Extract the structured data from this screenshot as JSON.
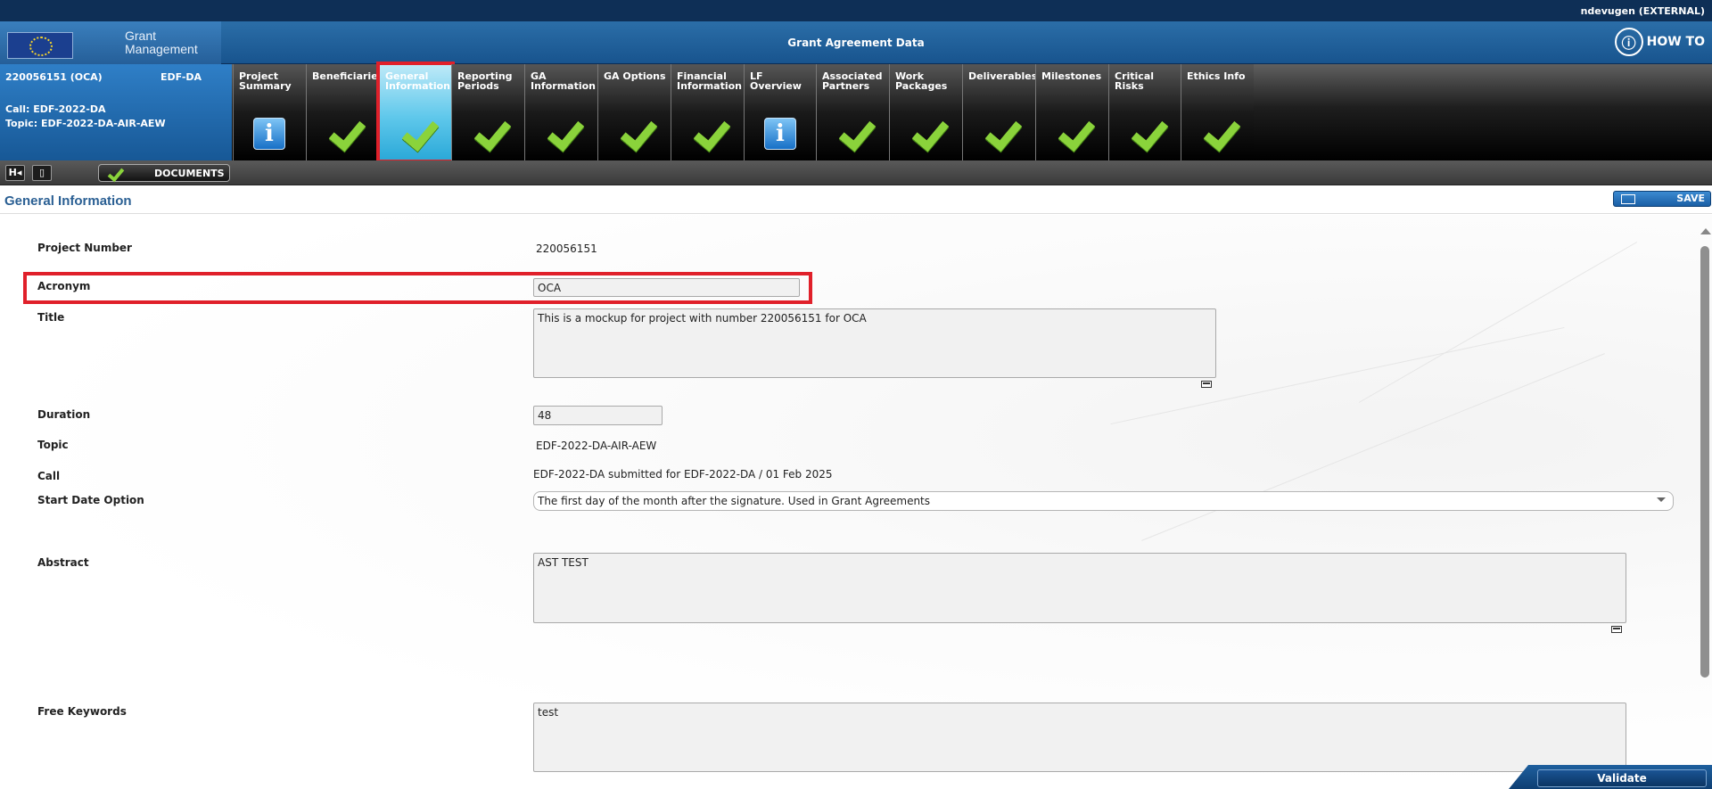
{
  "user": "ndevugen (EXTERNAL)",
  "brand": {
    "line1": "Grant",
    "line2": "Management"
  },
  "header_title": "Grant Agreement Data",
  "howto_label": "HOW TO",
  "project": {
    "id": "220056151 (OCA)",
    "programme": "EDF-DA",
    "call": "Call: EDF-2022-DA",
    "topic": "Topic: EDF-2022-DA-AIR-AEW"
  },
  "tabs": [
    {
      "label": "Project Summary",
      "icon": "info-icon"
    },
    {
      "label": "Beneficiaries",
      "icon": "checkmark-icon"
    },
    {
      "label": "General Information",
      "icon": "checkmark-icon"
    },
    {
      "label": "Reporting Periods",
      "icon": "checkmark-icon"
    },
    {
      "label": "GA Information",
      "icon": "checkmark-icon"
    },
    {
      "label": "GA Options",
      "icon": "checkmark-icon"
    },
    {
      "label": "Financial Information",
      "icon": "checkmark-icon"
    },
    {
      "label": "LF Overview",
      "icon": "info-icon"
    },
    {
      "label": "Associated Partners",
      "icon": "checkmark-icon"
    },
    {
      "label": "Work Packages",
      "icon": "checkmark-icon"
    },
    {
      "label": "Deliverables",
      "icon": "checkmark-icon"
    },
    {
      "label": "Milestones",
      "icon": "checkmark-icon"
    },
    {
      "label": "Critical Risks",
      "icon": "checkmark-icon"
    },
    {
      "label": "Ethics Info",
      "icon": "checkmark-icon"
    }
  ],
  "active_tab": "General Information",
  "toolbar": {
    "documents_label": "DOCUMENTS",
    "back_icon": "H◂"
  },
  "section_title": "General Information",
  "save_label": "SAVE",
  "form": {
    "project_number": {
      "label": "Project Number",
      "value": "220056151"
    },
    "acronym": {
      "label": "Acronym",
      "value": "OCA"
    },
    "title": {
      "label": "Title",
      "value": "This is a mockup for project with number 220056151 for OCA"
    },
    "duration": {
      "label": "Duration",
      "value": "48"
    },
    "topic": {
      "label": "Topic",
      "value": "EDF-2022-DA-AIR-AEW"
    },
    "call": {
      "label": "Call",
      "value": "EDF-2022-DA submitted for EDF-2022-DA / 01 Feb 2025"
    },
    "start_date_option": {
      "label": "Start Date Option",
      "value": "The first day of the month after the signature. Used in Grant Agreements"
    },
    "abstract": {
      "label": "Abstract",
      "value": "AST TEST"
    },
    "free_keywords": {
      "label": "Free Keywords",
      "value": "test"
    }
  },
  "validate_label": "Validate",
  "colors": {
    "accent": "#2a5f93",
    "highlight": "#e0202a",
    "check": "#8ad33b",
    "active_tab": "#5fc8eb"
  }
}
